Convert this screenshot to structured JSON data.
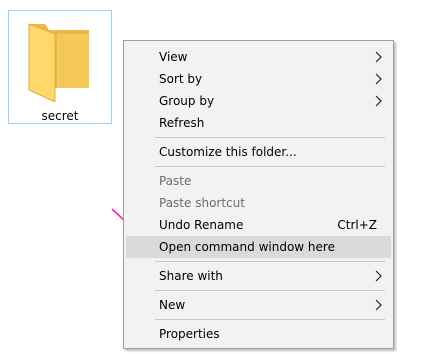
{
  "folder": {
    "name": "secret",
    "icon": "folder-icon"
  },
  "context_menu": {
    "view_label": "View",
    "sort_by_label": "Sort by",
    "group_by_label": "Group by",
    "refresh_label": "Refresh",
    "customize_label": "Customize this folder...",
    "paste_label": "Paste",
    "paste_shortcut_label": "Paste shortcut",
    "undo_rename_label": "Undo Rename",
    "undo_rename_shortcut": "Ctrl+Z",
    "open_cmd_label": "Open command window here",
    "share_with_label": "Share with",
    "new_label": "New",
    "properties_label": "Properties"
  },
  "colors": {
    "menu_background": "#f2f2f2",
    "highlight": "#dadada",
    "folder_yellow": "#ffd86b",
    "arrow_pink": "#ff1fb4"
  }
}
